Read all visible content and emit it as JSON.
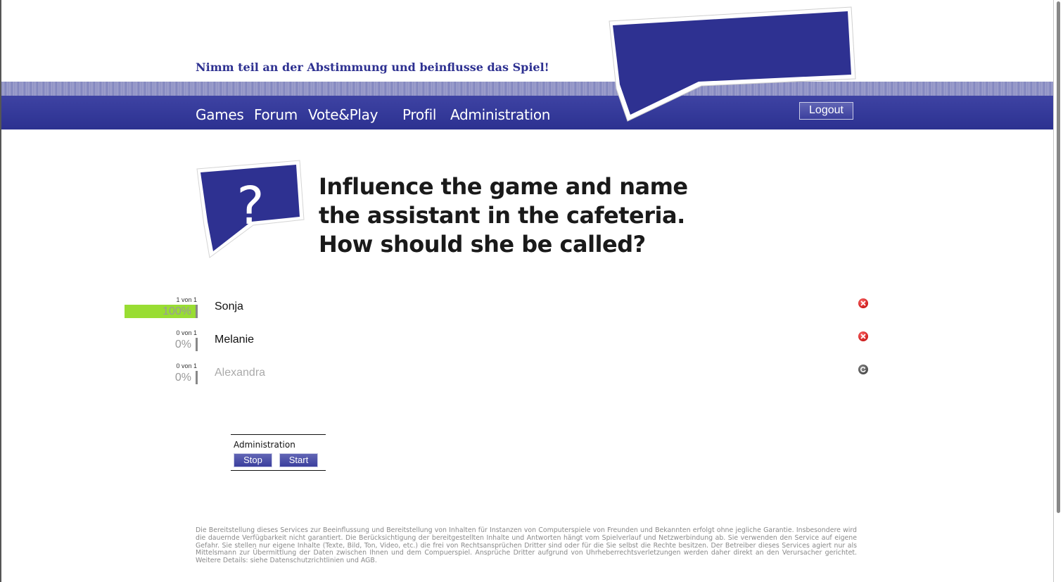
{
  "header": {
    "tagline": "Nimm teil an der Abstimmung und beinflusse das Spiel!",
    "nav": [
      {
        "label": "Games"
      },
      {
        "label": "Forum"
      },
      {
        "label": "Vote&Play"
      },
      {
        "label": "Profil"
      },
      {
        "label": "Administration"
      }
    ],
    "logout_label": "Logout"
  },
  "question": {
    "icon_glyph": "?",
    "lines": [
      "Influence the game and name",
      "the assistant in the cafeteria.",
      "How should she be called?"
    ]
  },
  "options": [
    {
      "count": "1 von 1",
      "percent": "100%",
      "share": 1.0,
      "name": "Sonja",
      "action": "delete-icon",
      "active": true
    },
    {
      "count": "0 von 1",
      "percent": "0%",
      "share": 0.0,
      "name": "Melanie",
      "action": "delete-icon",
      "active": true
    },
    {
      "count": "0 von 1",
      "percent": "0%",
      "share": 0.0,
      "name": "Alexandra",
      "action": "restore-icon",
      "active": false
    }
  ],
  "admin": {
    "title": "Administration",
    "stop_label": "Stop",
    "start_label": "Start"
  },
  "footer": {
    "text": "Die Bereitstellung dieses Services zur Beeinflussung und Bereitstellung von Inhalten für Instanzen von Computerspiele von Freunden und Bekannten erfolgt ohne jegliche Garantie. Insbesondere wird die dauernde Verfügbarkeit nicht garantiert. Die Berücksichtigung der bereitgestellten Inhalte und Antworten hängt vom Spielverlauf und Netzwerbindung ab. Sie verwenden den Service auf eigene Gefahr. Sie stellen nur eigene Inhalte (Texte, Bild, Ton, Video, etc.) die frei von Rechtsansprüchen Dritter sind oder für die Sie selbst die Rechte besitzen. Der Betreiber dieses Services agiert nur als Mittelsmann zur Übermittlung der Daten zwischen Ihnen und dem Compuerspiel. Ansprüche Dritter aufgrund von Uhrheberrechtsverletzungen werden daher direkt an den Verursacher gerichtet. Weitere Details: siehe Datenschutzrichtlinien und AGB."
  },
  "colors": {
    "brand_blue": "#2e3191",
    "vote_bar_green": "#99dd33",
    "delete_red": "#cc1b1b"
  }
}
